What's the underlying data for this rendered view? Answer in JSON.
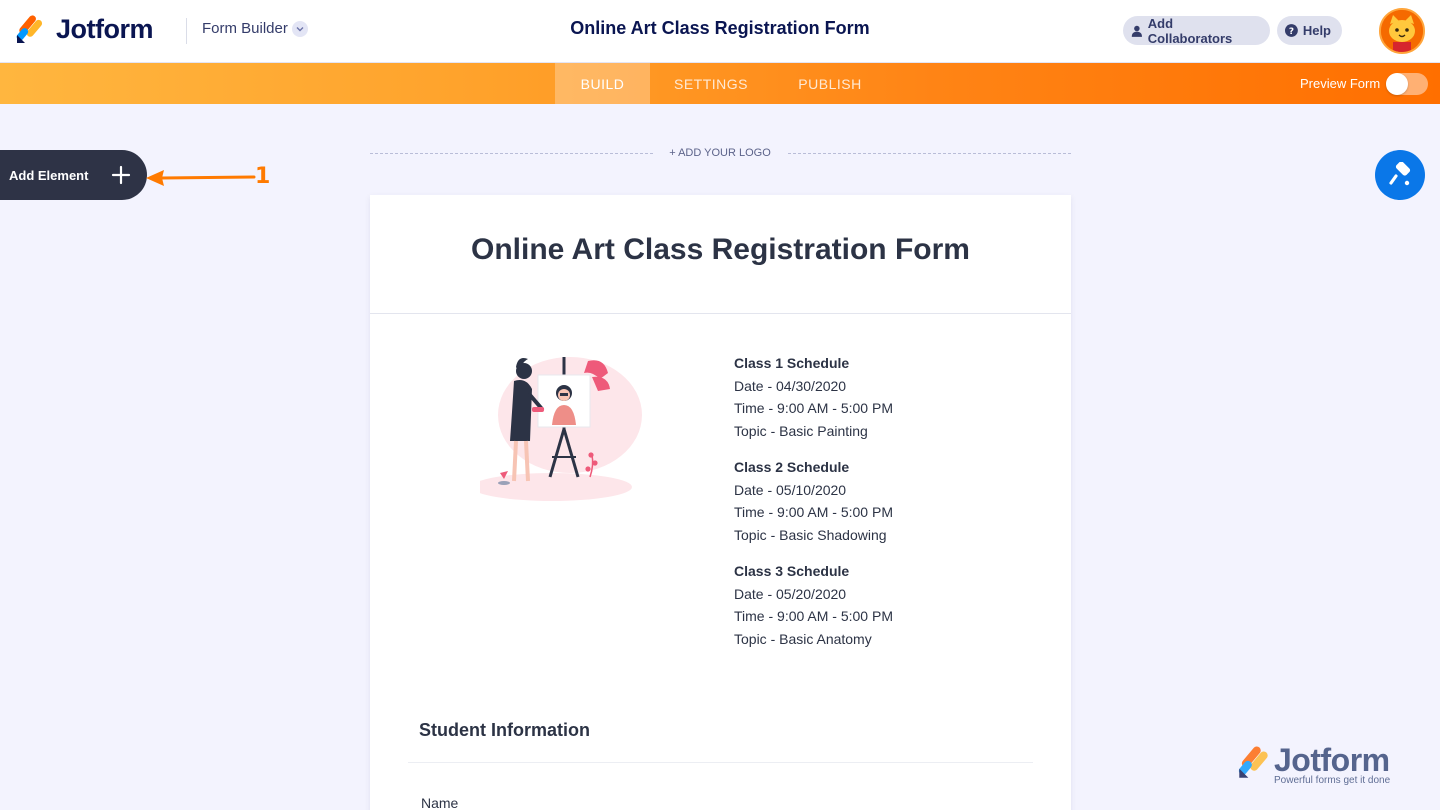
{
  "header": {
    "brand": "Jotform",
    "builder_label": "Form Builder",
    "form_title": "Online Art Class Registration Form",
    "add_collaborators": "Add Collaborators",
    "help": "Help",
    "avatar_icon": "cat-avatar-icon"
  },
  "nav": {
    "tabs": [
      {
        "label": "BUILD",
        "active": true
      },
      {
        "label": "SETTINGS",
        "active": false
      },
      {
        "label": "PUBLISH",
        "active": false
      }
    ],
    "preview_label": "Preview Form",
    "preview_enabled": false
  },
  "builder": {
    "add_element_label": "Add Element",
    "annotation_number": "1",
    "add_logo_label": "+ ADD YOUR LOGO"
  },
  "form": {
    "title": "Online Art Class Registration Form",
    "schedules": [
      {
        "heading": "Class 1 Schedule",
        "date": "Date - 04/30/2020",
        "time": "Time - 9:00 AM - 5:00 PM",
        "topic": "Topic - Basic Painting"
      },
      {
        "heading": "Class 2 Schedule",
        "date": "Date - 05/10/2020",
        "time": "Time - 9:00 AM - 5:00 PM",
        "topic": "Topic - Basic Shadowing"
      },
      {
        "heading": "Class 3 Schedule",
        "date": "Date - 05/20/2020",
        "time": "Time - 9:00 AM - 5:00 PM",
        "topic": "Topic - Basic Anatomy"
      }
    ],
    "section_title": "Student Information",
    "field_label": "Name"
  },
  "watermark": {
    "brand": "Jotform",
    "tagline": "Powerful forms get it done"
  },
  "colors": {
    "brand_navy": "#0a1551",
    "nav_start": "#ffb63f",
    "nav_end": "#ff6f00",
    "accent_blue": "#0a77e8"
  }
}
